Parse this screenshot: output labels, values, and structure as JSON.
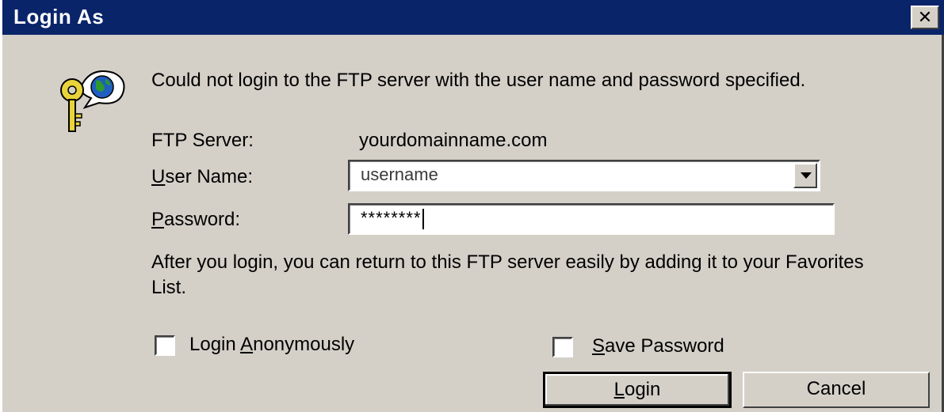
{
  "window": {
    "title": "Login As",
    "close_glyph": "✕"
  },
  "icon": {
    "name": "key-globe-icon"
  },
  "message": {
    "text": "Could not login to the FTP server with the user name and password specified."
  },
  "form": {
    "server_label": "FTP Server:",
    "server_value": "yourdomainname.com",
    "username_label_underline": "U",
    "username_label_rest": "ser Name:",
    "username_value": "username",
    "password_label_underline": "P",
    "password_label_rest": "assword:",
    "password_value": "********"
  },
  "info": {
    "text": "After you login, you can return to this FTP server easily by adding it to your Favorites List."
  },
  "options": {
    "anonymous_prefix": "Login ",
    "anonymous_underline": "A",
    "anonymous_rest": "nonymously",
    "anonymous_checked": false,
    "save_underline": "S",
    "save_rest": "ave Password",
    "save_checked": false
  },
  "buttons": {
    "login_underline": "L",
    "login_rest": "ogin",
    "cancel_label": "Cancel"
  },
  "colors": {
    "titlebar": "#0a246a",
    "face": "#d4d0c8"
  }
}
